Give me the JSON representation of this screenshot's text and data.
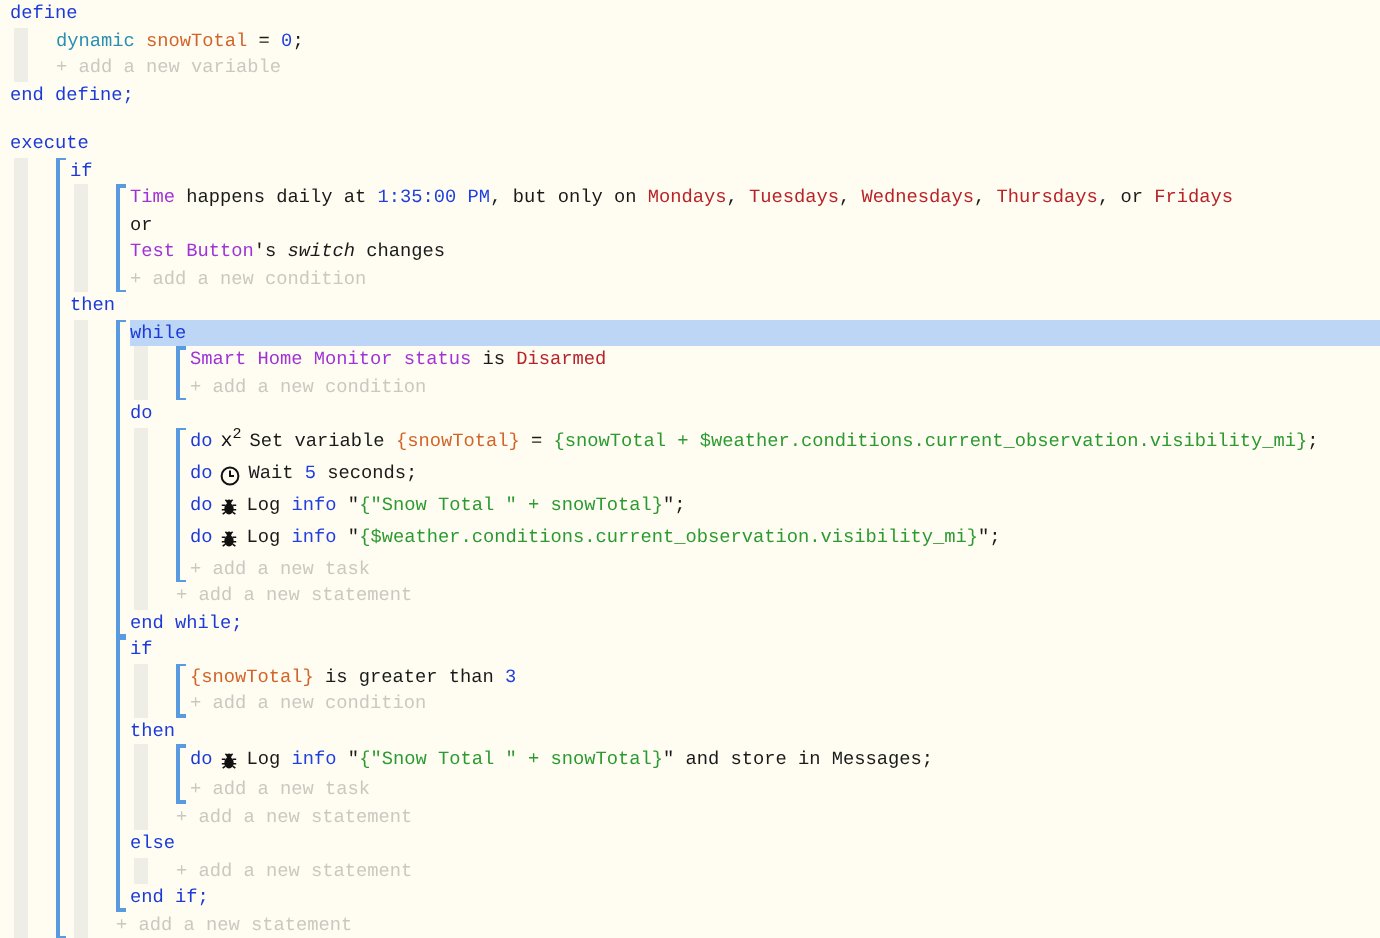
{
  "code": [
    {
      "kind": "keyword",
      "text": "define",
      "selected": false
    },
    {
      "kind": "block",
      "children": [
        {
          "kind": "line",
          "segments": [
            {
              "kind": "type",
              "text": "dynamic "
            },
            {
              "kind": "variable",
              "text": "snowTotal"
            },
            {
              "kind": "plain",
              "text": " = "
            },
            {
              "kind": "number",
              "text": "0"
            },
            {
              "kind": "plain",
              "text": ";"
            }
          ]
        },
        {
          "kind": "add",
          "text": "+ add a new variable"
        }
      ]
    },
    {
      "kind": "keyword",
      "text": "end define;",
      "selected": false
    },
    {
      "kind": "blank"
    },
    {
      "kind": "keyword",
      "text": "execute",
      "selected": false
    },
    {
      "kind": "block",
      "children": [
        {
          "kind": "bracket",
          "children": [
            {
              "kind": "keyword",
              "text": "if",
              "selected": false
            },
            {
              "kind": "block",
              "children": [
                {
                  "kind": "bracket",
                  "children": [
                    {
                      "kind": "line",
                      "segments": [
                        {
                          "kind": "device",
                          "text": "Time"
                        },
                        {
                          "kind": "plain",
                          "text": " happens daily at "
                        },
                        {
                          "kind": "number",
                          "text": "1:35:00 PM"
                        },
                        {
                          "kind": "plain",
                          "text": ", but only on "
                        },
                        {
                          "kind": "value",
                          "text": "Mondays"
                        },
                        {
                          "kind": "plain",
                          "text": ", "
                        },
                        {
                          "kind": "value",
                          "text": "Tuesdays"
                        },
                        {
                          "kind": "plain",
                          "text": ", "
                        },
                        {
                          "kind": "value",
                          "text": "Wednesdays"
                        },
                        {
                          "kind": "plain",
                          "text": ", "
                        },
                        {
                          "kind": "value",
                          "text": "Thursdays"
                        },
                        {
                          "kind": "plain",
                          "text": ", or "
                        },
                        {
                          "kind": "value",
                          "text": "Fridays"
                        }
                      ]
                    },
                    {
                      "kind": "line",
                      "segments": [
                        {
                          "kind": "plain",
                          "text": "or"
                        }
                      ]
                    },
                    {
                      "kind": "line",
                      "segments": [
                        {
                          "kind": "device",
                          "text": "Test Button"
                        },
                        {
                          "kind": "plain",
                          "text": "'s "
                        },
                        {
                          "kind": "italic",
                          "text": "switch"
                        },
                        {
                          "kind": "plain",
                          "text": " changes"
                        }
                      ]
                    },
                    {
                      "kind": "add",
                      "text": "+ add a new condition"
                    }
                  ]
                }
              ]
            },
            {
              "kind": "keyword",
              "text": "then",
              "selected": false
            },
            {
              "kind": "block",
              "children": [
                {
                  "kind": "bracket",
                  "children": [
                    {
                      "kind": "keyword",
                      "text": "while",
                      "selected": true
                    },
                    {
                      "kind": "block",
                      "children": [
                        {
                          "kind": "bracket",
                          "children": [
                            {
                              "kind": "line",
                              "segments": [
                                {
                                  "kind": "device",
                                  "text": "Smart Home Monitor status"
                                },
                                {
                                  "kind": "plain",
                                  "text": " is "
                                },
                                {
                                  "kind": "value",
                                  "text": "Disarmed"
                                }
                              ]
                            },
                            {
                              "kind": "add",
                              "text": "+ add a new condition"
                            }
                          ]
                        }
                      ]
                    },
                    {
                      "kind": "keyword",
                      "text": "do",
                      "selected": false
                    },
                    {
                      "kind": "block",
                      "children": [
                        {
                          "kind": "bracket",
                          "children": [
                            {
                              "kind": "variable_task",
                              "lead": "do",
                              "symbol": "x$^{2}$",
                              "segments": [
                                {
                                  "kind": "plain",
                                  "text": "Set variable "
                                },
                                {
                                  "kind": "variable",
                                  "text": "{snowTotal}"
                                },
                                {
                                  "kind": "plain",
                                  "text": " = "
                                },
                                {
                                  "kind": "expr",
                                  "text": "{snowTotal + $weather.conditions.current_observation.visibility_mi}"
                                },
                                {
                                  "kind": "plain",
                                  "text": ";"
                                }
                              ]
                            },
                            {
                              "kind": "wait_task",
                              "lead": "do",
                              "segments": [
                                {
                                  "kind": "plain",
                                  "text": "Wait "
                                },
                                {
                                  "kind": "number",
                                  "text": "5"
                                },
                                {
                                  "kind": "plain",
                                  "text": " seconds;"
                                }
                              ]
                            },
                            {
                              "kind": "log_task",
                              "lead": "do",
                              "segments": [
                                {
                                  "kind": "plain",
                                  "text": "Log "
                                },
                                {
                                  "kind": "number",
                                  "text": "info"
                                },
                                {
                                  "kind": "plain",
                                  "text": " \""
                                },
                                {
                                  "kind": "expr",
                                  "text": "{\"Snow Total \" + snowTotal}"
                                },
                                {
                                  "kind": "plain",
                                  "text": "\";"
                                }
                              ]
                            },
                            {
                              "kind": "log_task",
                              "lead": "do",
                              "segments": [
                                {
                                  "kind": "plain",
                                  "text": "Log "
                                },
                                {
                                  "kind": "number",
                                  "text": "info"
                                },
                                {
                                  "kind": "plain",
                                  "text": " \""
                                },
                                {
                                  "kind": "expr",
                                  "text": "{$weather.conditions.current_observation.visibility_mi}"
                                },
                                {
                                  "kind": "plain",
                                  "text": "\";"
                                }
                              ]
                            },
                            {
                              "kind": "add",
                              "text": "+ add a new task"
                            }
                          ]
                        },
                        {
                          "kind": "add",
                          "text": "+ add a new statement"
                        }
                      ]
                    },
                    {
                      "kind": "keyword",
                      "text": "end while;",
                      "selected": false
                    }
                  ]
                },
                {
                  "kind": "bracket",
                  "children": [
                    {
                      "kind": "keyword",
                      "text": "if",
                      "selected": false
                    },
                    {
                      "kind": "block",
                      "children": [
                        {
                          "kind": "bracket",
                          "children": [
                            {
                              "kind": "line",
                              "segments": [
                                {
                                  "kind": "variable",
                                  "text": "{snowTotal}"
                                },
                                {
                                  "kind": "plain",
                                  "text": " is greater than "
                                },
                                {
                                  "kind": "number",
                                  "text": "3"
                                }
                              ]
                            },
                            {
                              "kind": "add",
                              "text": "+ add a new condition"
                            }
                          ]
                        }
                      ]
                    },
                    {
                      "kind": "keyword",
                      "text": "then",
                      "selected": false
                    },
                    {
                      "kind": "block",
                      "children": [
                        {
                          "kind": "bracket",
                          "children": [
                            {
                              "kind": "log_task",
                              "lead": "do",
                              "segments": [
                                {
                                  "kind": "plain",
                                  "text": "Log "
                                },
                                {
                                  "kind": "number",
                                  "text": "info"
                                },
                                {
                                  "kind": "plain",
                                  "text": " \""
                                },
                                {
                                  "kind": "expr",
                                  "text": "{\"Snow Total \" + snowTotal}"
                                },
                                {
                                  "kind": "plain",
                                  "text": "\" and store in Messages;"
                                }
                              ]
                            },
                            {
                              "kind": "add",
                              "text": "+ add a new task"
                            }
                          ]
                        },
                        {
                          "kind": "add",
                          "text": "+ add a new statement"
                        }
                      ]
                    },
                    {
                      "kind": "keyword",
                      "text": "else",
                      "selected": false
                    },
                    {
                      "kind": "block",
                      "children": [
                        {
                          "kind": "add",
                          "text": "+ add a new statement"
                        }
                      ]
                    },
                    {
                      "kind": "keyword",
                      "text": "end if;",
                      "selected": false
                    }
                  ]
                },
                {
                  "kind": "add",
                  "text": "+ add a new statement"
                }
              ]
            }
          ]
        }
      ]
    }
  ]
}
